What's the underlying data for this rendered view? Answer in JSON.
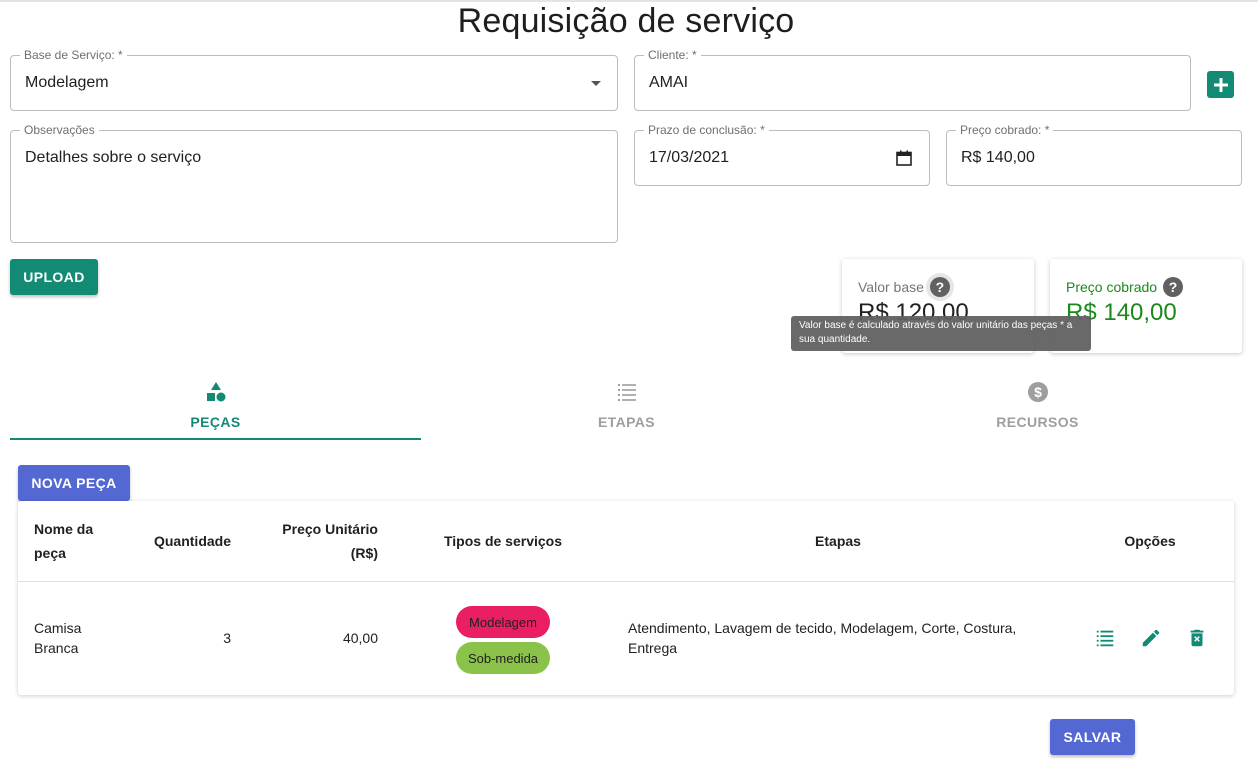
{
  "page": {
    "title": "Requisição de serviço"
  },
  "form": {
    "base_servico": {
      "label": "Base de Serviço: *",
      "value": "Modelagem"
    },
    "cliente": {
      "label": "Cliente: *",
      "value": "AMAI"
    },
    "observacoes": {
      "label": "Observações",
      "value": "Detalhes sobre o serviço"
    },
    "prazo": {
      "label": "Prazo de conclusão: *",
      "value": "17/03/2021"
    },
    "preco": {
      "label": "Preço cobrado: *",
      "value": "R$ 140,00"
    }
  },
  "buttons": {
    "upload": "UPLOAD",
    "nova_peca": "NOVA PEÇA",
    "salvar": "SALVAR"
  },
  "summary": {
    "valor_base": {
      "label": "Valor base",
      "value": "R$ 120,00",
      "help": "?"
    },
    "preco_cobrado": {
      "label": "Preço cobrado",
      "value": "R$ 140,00",
      "help": "?"
    },
    "tooltip": "Valor base é calculado através do valor unitário das peças * a sua quantidade."
  },
  "tabs": [
    {
      "label": "PEÇAS",
      "icon": "shapes-icon",
      "active": true
    },
    {
      "label": "ETAPAS",
      "icon": "list-icon",
      "active": false
    },
    {
      "label": "RECURSOS",
      "icon": "money-icon",
      "active": false
    }
  ],
  "table": {
    "headers": {
      "nome": "Nome da peça",
      "quantidade": "Quantidade",
      "preco": "Preço Unitário (R$)",
      "tipos": "Tipos de serviços",
      "etapas": "Etapas",
      "opcoes": "Opções"
    },
    "rows": [
      {
        "nome": "Camisa Branca",
        "quantidade": "3",
        "preco": "40,00",
        "tipos": [
          "Modelagem",
          "Sob-medida"
        ],
        "etapas": "Atendimento, Lavagem de tecido, Modelagem, Corte, Costura, Entrega"
      }
    ]
  },
  "colors": {
    "primary": "#138a74",
    "secondary": "#5468d4",
    "chip_modelagem": "#e91e63",
    "chip_sob_medida": "#8bc34a",
    "price_green": "#1a8a1a"
  }
}
